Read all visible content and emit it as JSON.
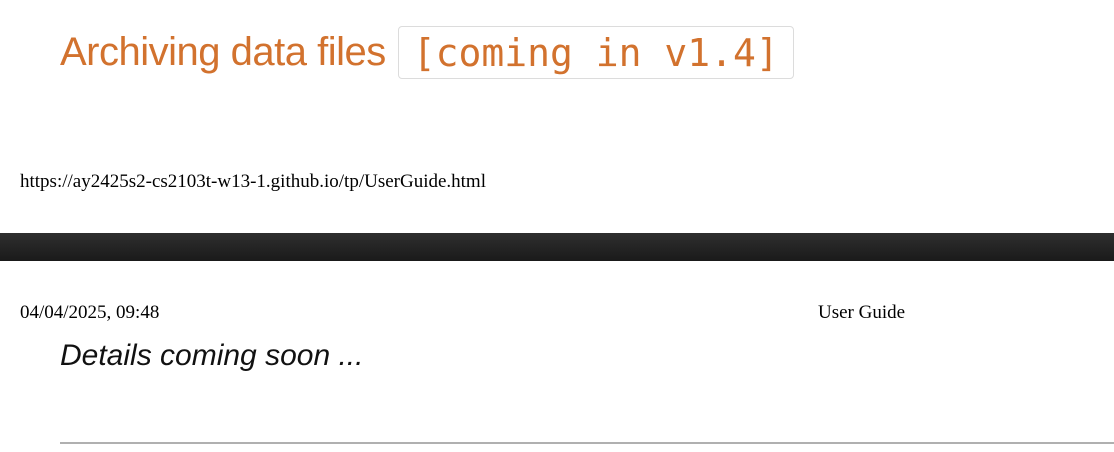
{
  "section": {
    "heading": "Archiving data files",
    "tag": "[coming in v1.4]"
  },
  "print_footer": {
    "url": "https://ay2425s2-cs2103t-w13-1.github.io/tp/UserGuide.html"
  },
  "print_header": {
    "datetime": "04/04/2025, 09:48",
    "title": "User Guide"
  },
  "content": {
    "details": "Details coming soon ..."
  },
  "colors": {
    "heading": "#d2722e",
    "page_break_band": "#222222",
    "divider": "#b0b0b0"
  }
}
